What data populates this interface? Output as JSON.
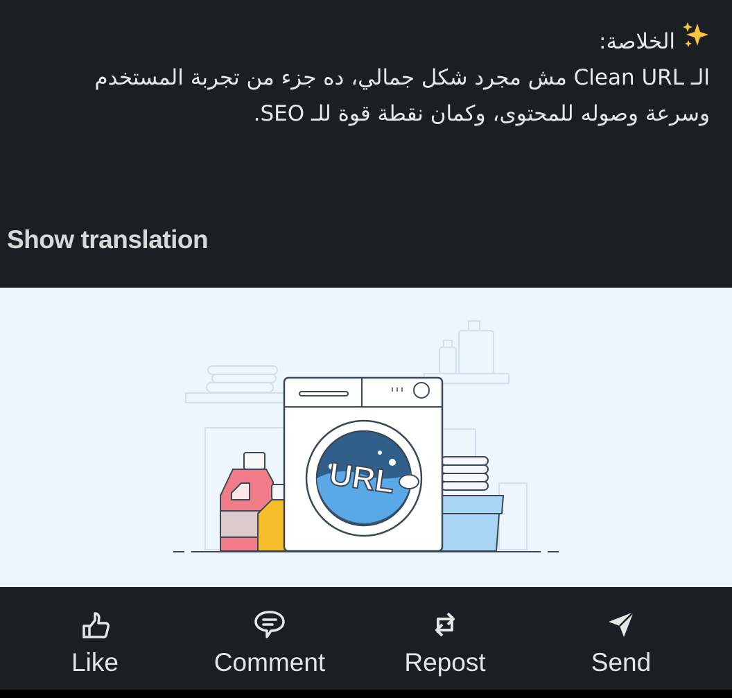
{
  "post": {
    "sparkle_icon": "sparkles-emoji",
    "heading": "الخلاصة:",
    "line1": "الـ Clean URL مش مجرد شكل جمالي، ده جزء من تجربة المستخدم",
    "line2": "وسرعة وصوله للمحتوى، وكمان نقطة قوة للـ SEO."
  },
  "translation": {
    "label": "Show translation"
  },
  "illustration": {
    "drum_text": "URL",
    "colors": {
      "background": "#eef6fd",
      "water": "#5aa9e6",
      "drum": "#2f5f8a",
      "bottle_pink": "#f07c8a",
      "bottle_yellow": "#f7bd2a"
    }
  },
  "actions": [
    {
      "label": "Like",
      "icon": "thumbs-up-icon"
    },
    {
      "label": "Comment",
      "icon": "comment-icon"
    },
    {
      "label": "Repost",
      "icon": "repost-icon"
    },
    {
      "label": "Send",
      "icon": "send-icon"
    }
  ]
}
